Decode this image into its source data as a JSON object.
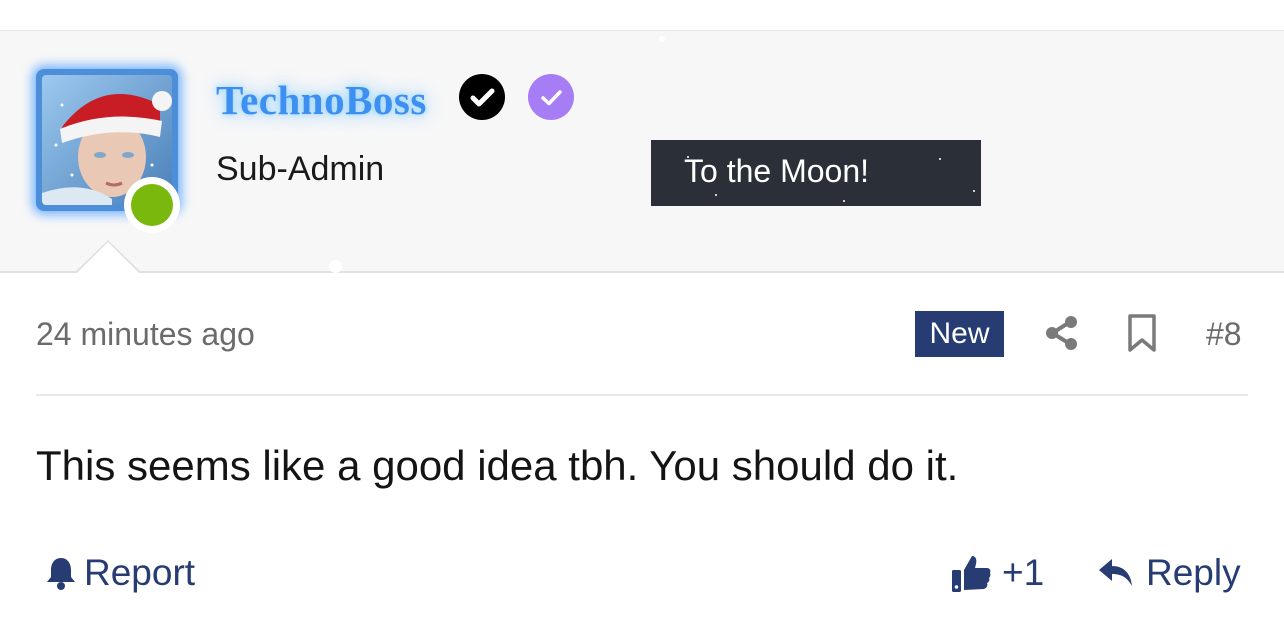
{
  "user": {
    "name": "TechnoBoss",
    "title": "Sub-Admin",
    "banner": "To the Moon!",
    "online": true
  },
  "post": {
    "time": "24 minutes ago",
    "new_badge": "New",
    "number": "#8",
    "body": "This seems like a good idea tbh. You should do it."
  },
  "actions": {
    "report": "Report",
    "reaction_count": "+1",
    "reply": "Reply"
  },
  "icons": {
    "badge_primary": "verified-check-icon",
    "badge_secondary": "verified-check-icon",
    "share": "share-icon",
    "bookmark": "bookmark-icon",
    "report": "bell-icon",
    "like": "thumbs-up-icon",
    "reply": "reply-icon"
  },
  "colors": {
    "username": "#3d8ff0",
    "accent": "#263c72",
    "online": "#7ab80e",
    "badge_purple": "#a77df5",
    "banner_bg": "#2a2f38"
  }
}
